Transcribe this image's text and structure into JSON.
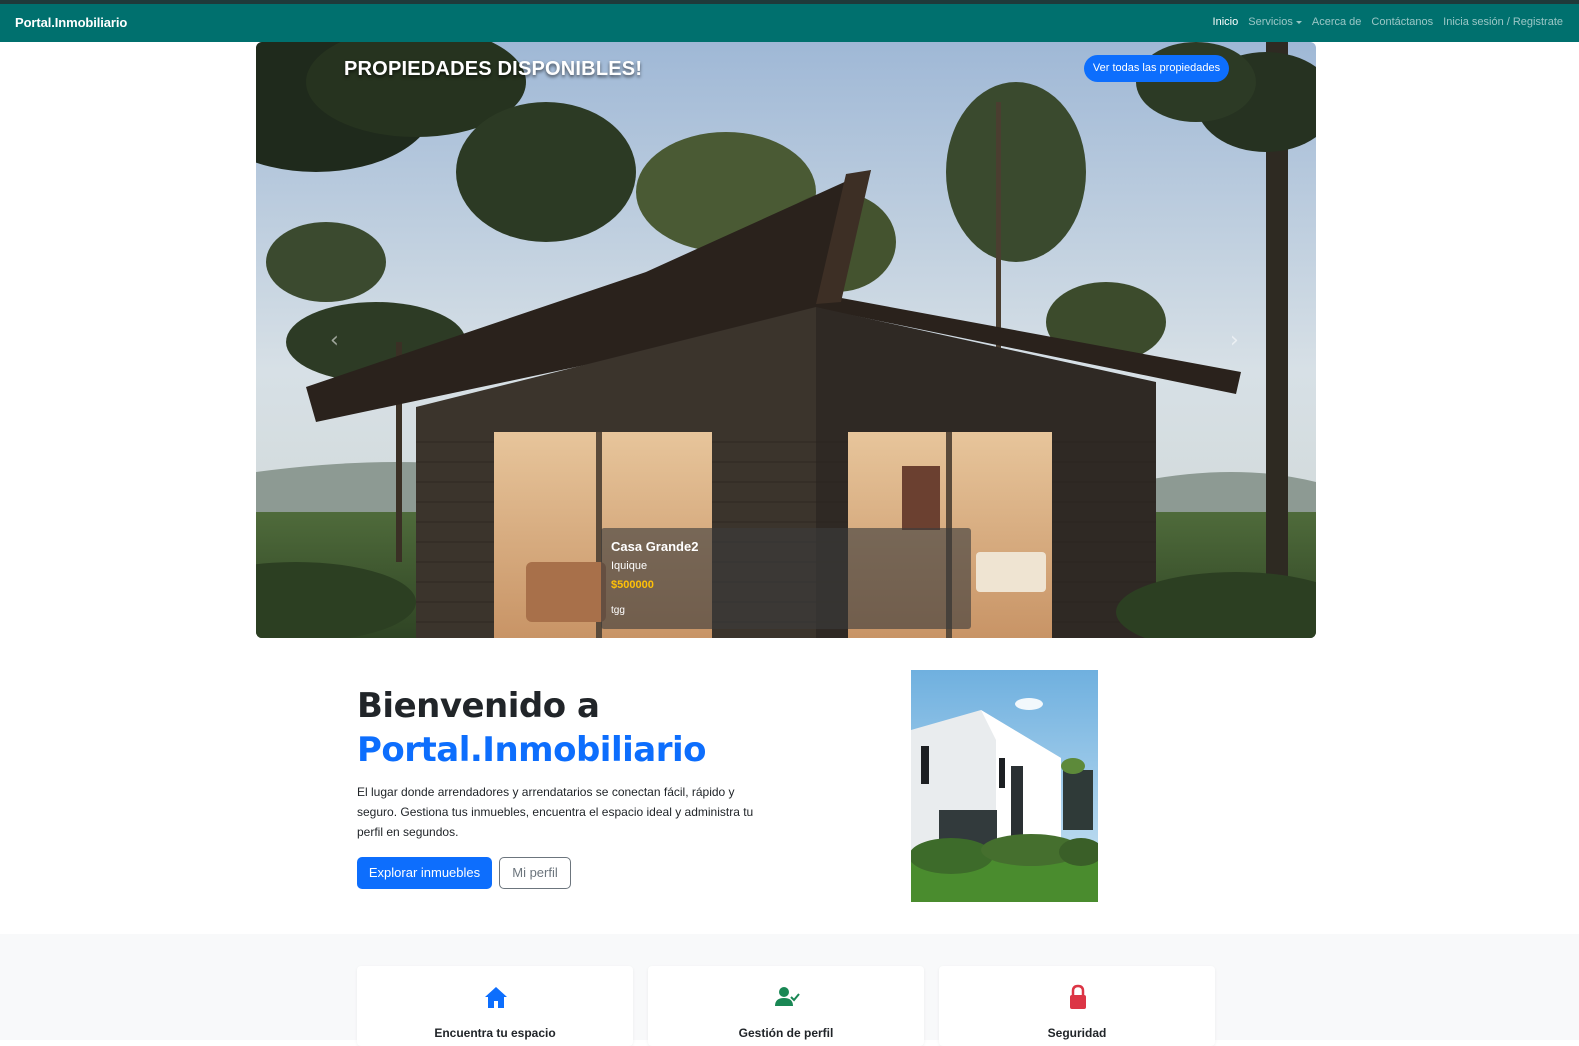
{
  "nav": {
    "brand": "Portal.Inmobiliario",
    "items": [
      {
        "label": "Inicio",
        "active": true
      },
      {
        "label": "Servicios",
        "dropdown": true
      },
      {
        "label": "Acerca de"
      },
      {
        "label": "Contáctanos"
      },
      {
        "label": "Inicia sesión / Registrate"
      }
    ]
  },
  "hero": {
    "title": "PROPIEDADES DISPONIBLES!",
    "view_all_label": "Ver todas las propiedades",
    "prev_icon": "chevron-left-icon",
    "next_icon": "chevron-right-icon",
    "slide": {
      "name": "Casa Grande2",
      "city": "Iquique",
      "price": "$500000",
      "description": "tgg"
    }
  },
  "welcome": {
    "title_line1": "Bienvenido a",
    "title_line2": "Portal.Inmobiliario",
    "lead": "El lugar donde arrendadores y arrendatarios se conectan fácil, rápido y seguro. Gestiona tus inmuebles, encuentra el espacio ideal y administra tu perfil en segundos.",
    "primary_button": "Explorar inmuebles",
    "secondary_button": "Mi perfil"
  },
  "features": [
    {
      "icon": "house-icon",
      "title": "Encuentra tu espacio",
      "color": "#0d6efd"
    },
    {
      "icon": "user-check-icon",
      "title": "Gestión de perfil",
      "color": "#198754"
    },
    {
      "icon": "lock-icon",
      "title": "Seguridad",
      "color": "#dc3545"
    }
  ],
  "colors": {
    "navbar": "#00706e",
    "primary": "#0d6efd",
    "price": "#ffc107"
  }
}
